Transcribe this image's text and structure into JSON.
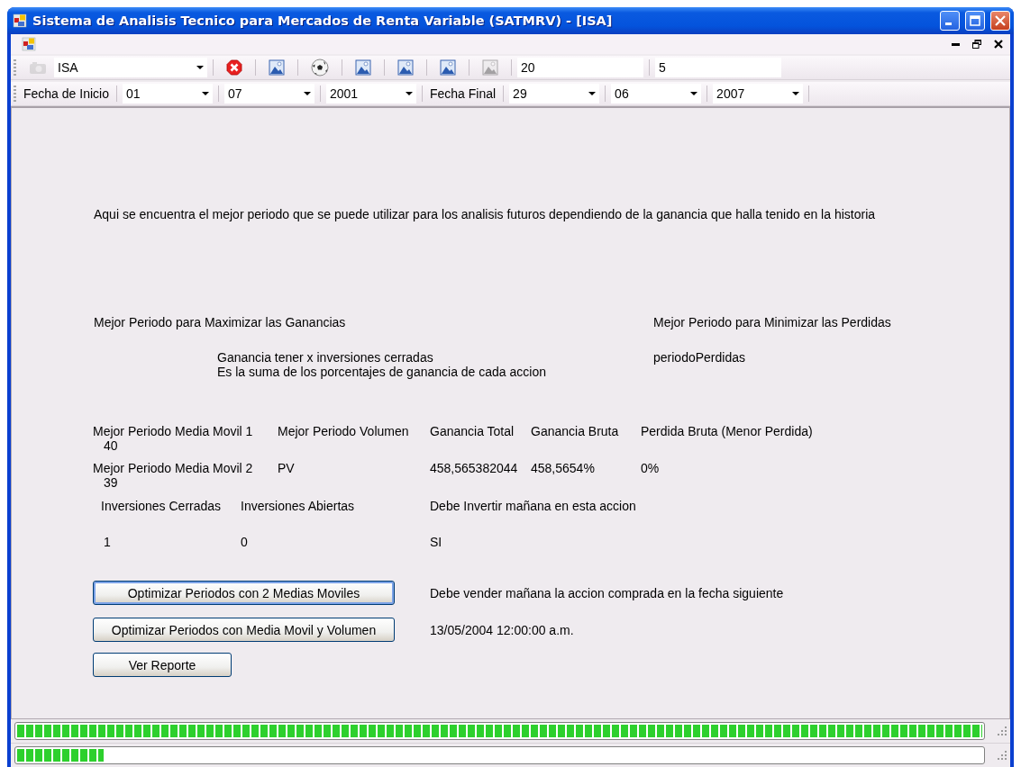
{
  "window": {
    "title": "Sistema de Analisis Tecnico para Mercados de Renta Variable (SATMRV) - [ISA]"
  },
  "toolbar": {
    "items": [
      {
        "kind": "camera",
        "disabled": true
      },
      {
        "kind": "combo",
        "value": "ISA"
      },
      {
        "kind": "stop",
        "disabled": false
      },
      {
        "kind": "image",
        "disabled": false
      },
      {
        "kind": "ball",
        "disabled": false
      },
      {
        "kind": "image",
        "disabled": false
      },
      {
        "kind": "image",
        "disabled": false
      },
      {
        "kind": "image",
        "disabled": false
      },
      {
        "kind": "image",
        "disabled": true
      },
      {
        "kind": "field",
        "value": "20"
      },
      {
        "kind": "field",
        "value": "5"
      }
    ]
  },
  "date_toolbar": {
    "items": [
      {
        "kind": "label",
        "text": "Fecha de Inicio"
      },
      {
        "kind": "combo",
        "value": "01"
      },
      {
        "kind": "combo",
        "value": "07"
      },
      {
        "kind": "combo",
        "value": "2001"
      },
      {
        "kind": "label",
        "text": "Fecha Final"
      },
      {
        "kind": "combo",
        "value": "29"
      },
      {
        "kind": "combo",
        "value": "06"
      },
      {
        "kind": "combo",
        "value": "2007"
      }
    ]
  },
  "description": "Aqui se encuentra el mejor periodo que se puede utilizar para los analisis futuros dependiendo de la ganancia que halla tenido en la historia",
  "max_heading": "Mejor Periodo para Maximizar las Ganancias",
  "min_heading": "Mejor Periodo para Minimizar las Perdidas",
  "gain_note": [
    "Ganancia tener x inversiones cerradas",
    "Es la suma de los porcentajes de ganancia de cada accion"
  ],
  "loss_period": "periodoPerdidas",
  "headers": [
    "Mejor Periodo Media Movil 1",
    "Mejor Periodo Volumen",
    "Ganancia Total",
    "Ganancia Bruta",
    "Perdida Bruta (Menor Perdida)"
  ],
  "ma1_value": "40",
  "row2": [
    "Mejor Periodo Media Movil 2",
    "PV",
    "458,565382044",
    "458,5654%",
    "0%"
  ],
  "ma2_value": "39",
  "investment_headers": [
    "Inversiones Cerradas",
    "Inversiones Abiertas",
    "Debe Invertir mañana en esta accion"
  ],
  "investment_values": [
    "1",
    "0",
    "SI"
  ],
  "buttons": [
    {
      "label": "Optimizar Periodos con 2 Medias Moviles",
      "default": true,
      "note": "Debe vender mañana la accion comprada en la fecha siguiente"
    },
    {
      "label": "Optimizar Periodos con Media Movil y Volumen",
      "default": false,
      "note": "13/05/2004 12:00:00 a.m."
    },
    {
      "label": "Ver Reporte",
      "default": false
    }
  ],
  "progress_bars": [
    {
      "level": 1.0
    },
    {
      "level": 0.09
    }
  ]
}
